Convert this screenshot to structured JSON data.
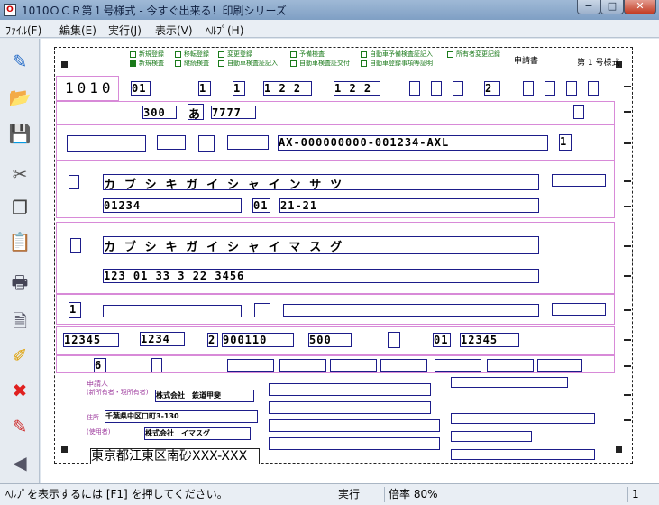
{
  "window": {
    "title": "1010ＯＣＲ第１号様式 - 今すぐ出来る！印刷シリーズ",
    "icon": "app-icon"
  },
  "menu": [
    "ﾌｧｲﾙ(F)",
    "編集(E)",
    "実行(J)",
    "表示(V)",
    "ﾍﾙﾌﾟ(H)"
  ],
  "toolbar": [
    "ruler-pencil-icon",
    "open-folder-icon",
    "save-disk-icon",
    "cut-icon",
    "copy-icon",
    "paste-icon",
    "print-icon",
    "preview-icon",
    "eraser-icon",
    "delete-x-icon",
    "clear-icon",
    "back-arrow-icon"
  ],
  "form": {
    "checkboxes": [
      {
        "label": "新規登録",
        "checked": false
      },
      {
        "label": "移転登録",
        "checked": false
      },
      {
        "label": "変更登録",
        "checked": false
      },
      {
        "label": "予備検査",
        "checked": false
      },
      {
        "label": "自動車予備検査証記入",
        "checked": false
      },
      {
        "label": "所有者変更記録",
        "checked": false
      },
      {
        "label": "新規検査",
        "checked": true
      },
      {
        "label": "継続検査",
        "checked": false
      },
      {
        "label": "自動車検査証記入",
        "checked": false
      },
      {
        "label": "自動車検査証交付",
        "checked": false
      },
      {
        "label": "自動車登録事項等証明",
        "checked": false
      }
    ],
    "header_right": "申請書",
    "sheet_no": "第 1 号様式",
    "form_code": "1010",
    "row1": {
      "v1": "01",
      "v2": "1",
      "v3": "1",
      "v4": "1 2 2",
      "v5": "1 2 2",
      "v6": "2"
    },
    "plate": {
      "num": "300",
      "kana": "あ",
      "serial": "7777"
    },
    "chassis": "AX-000000000-001234-AXL",
    "chassis_suffix": "1",
    "name1_kana": "カ ブ シ キ ガ イ シ ャ  イ ン サ ツ",
    "code1": "01234",
    "code1b": "01",
    "addr1": "21-21",
    "name2_kana": "カ ブ シ キ ガ イ シ ャ  イ マ ス グ",
    "addr2": "123  01  33  3  22  3456",
    "box_one": "1",
    "r_nums": {
      "a": "12345",
      "b": "1234",
      "c_pre": "2",
      "c": "900110",
      "d": "500",
      "e": "01",
      "f": "12345"
    },
    "box_six": "6",
    "applicant_label": "申請人",
    "owner_label": "(新所有者・現所有者)",
    "owner_name": "株式会社　鉄道甲斐",
    "address_label": "住所",
    "address_value": "千葉県中区口町3-130",
    "user_label": "(使用者)",
    "user_name": "株式会社　イマスグ",
    "big_address": "東京都江東区南砂XXX-XXX"
  },
  "status": {
    "help": "ﾍﾙﾌﾟを表示するには [F1] を押してください。",
    "mode": "実行",
    "zoom": "倍率 80%",
    "page": "1"
  }
}
